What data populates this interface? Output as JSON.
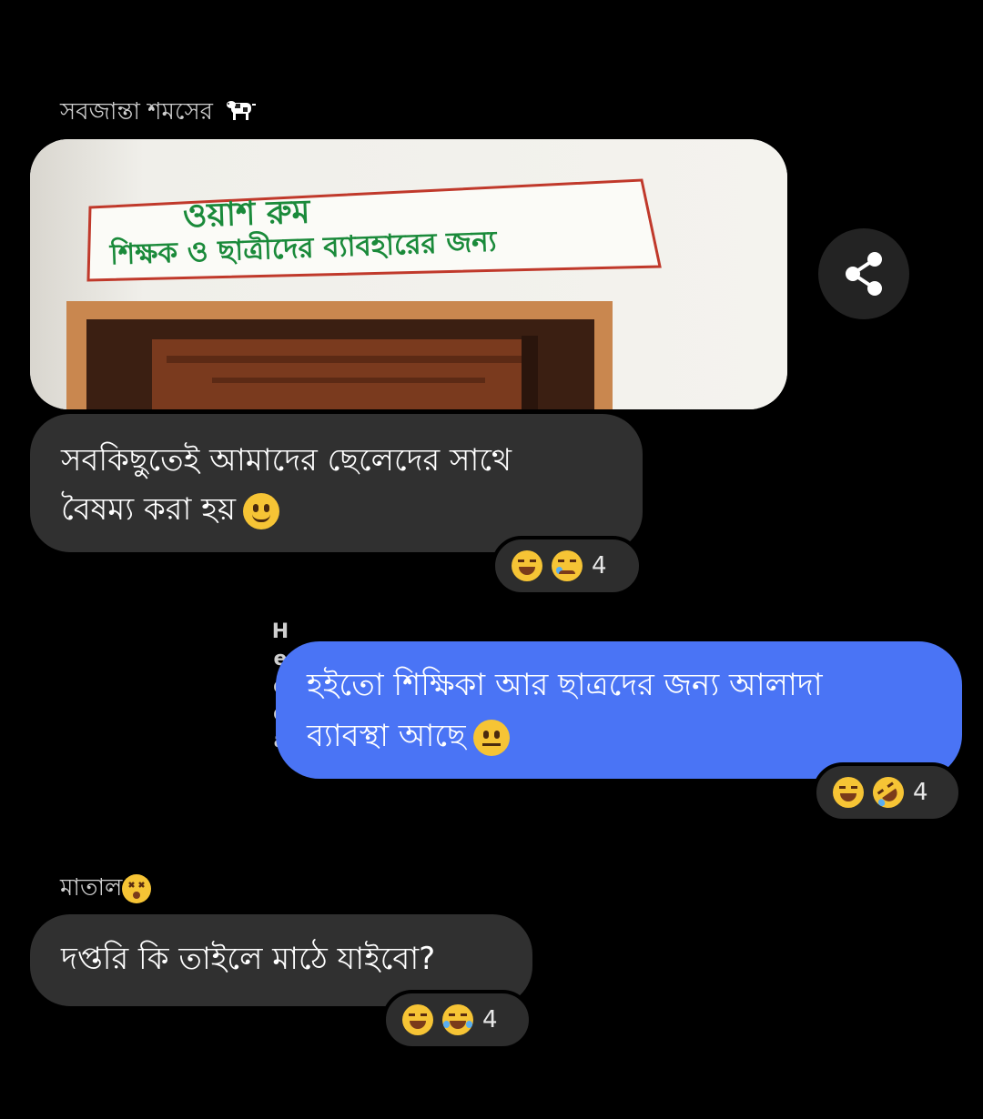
{
  "messages": [
    {
      "sender": "সবজান্তা শমসের",
      "sender_icon": "cow-icon",
      "text_lines": [
        "সবকিছুতেই আমাদের ছেলেদের সাথে",
        "বৈষম্য করা হয়"
      ],
      "text_emoji": "slightly-smiling-face-icon",
      "reactions": {
        "icons": [
          "grinning-squinting-face-icon",
          "sad-tear-face-icon"
        ],
        "count": "4"
      }
    },
    {
      "sender": "Hedda",
      "text_lines": [
        "হইতো শিক্ষিকা আর ছাত্রদের জন্য আলাদা",
        "ব্যাবস্থা আছে"
      ],
      "text_emoji": "neutral-face-icon",
      "reactions": {
        "icons": [
          "grinning-squinting-face-icon",
          "rolling-on-floor-laughing-icon"
        ],
        "count": "4"
      }
    },
    {
      "sender": "মাতাল",
      "sender_icon": "dizzy-face-icon",
      "text_lines": [
        "দপ্তরি কি তাইলে মাঠে যাইবো?"
      ],
      "reactions": {
        "icons": [
          "grinning-squinting-face-icon",
          "face-with-tears-of-joy-icon"
        ],
        "count": "4"
      }
    }
  ],
  "photo": {
    "sign_line1": "ওয়াশ রুম",
    "sign_line2": "শিক্ষক ও ছাত্রীদের ব্যাবহারের জন্য"
  },
  "share_icon": "share-icon",
  "colors": {
    "background": "#000000",
    "gray_bubble": "#303030",
    "blue_bubble": "#4a74f5",
    "sign_text": "#1a8a3a",
    "sign_border": "#c0392b"
  }
}
